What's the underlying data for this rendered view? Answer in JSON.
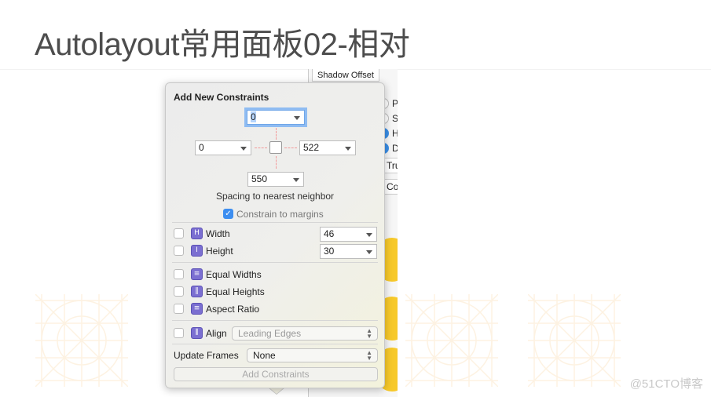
{
  "slide": {
    "title": "Autolayout常用面板02-相对",
    "watermark": "@51CTO博客"
  },
  "inspector": {
    "header": "Shadow Offset",
    "radio_labels": [
      "P",
      "S",
      "H",
      "D"
    ],
    "field1": "Tru",
    "field2": "Co"
  },
  "popover": {
    "title": "Add New Constraints",
    "top": "0",
    "left": "0",
    "right": "522",
    "bottom": "550",
    "spacing_label": "Spacing to nearest neighbor",
    "constrain_margins": {
      "label": "Constrain to margins",
      "checked": true
    },
    "width": {
      "label": "Width",
      "value": "46",
      "checked": false
    },
    "height": {
      "label": "Height",
      "value": "30",
      "checked": false
    },
    "equal_widths": {
      "label": "Equal Widths",
      "checked": false
    },
    "equal_heights": {
      "label": "Equal Heights",
      "checked": false
    },
    "aspect_ratio": {
      "label": "Aspect Ratio",
      "checked": false
    },
    "align": {
      "label": "Align",
      "value": "Leading Edges",
      "checked": false
    },
    "update_frames": {
      "label": "Update Frames",
      "value": "None"
    },
    "add_button": "Add Constraints"
  },
  "colors": {
    "accent": "#3d8ef0",
    "constraint_icon": "#7b6fd1",
    "guide": "#f29a9a"
  }
}
